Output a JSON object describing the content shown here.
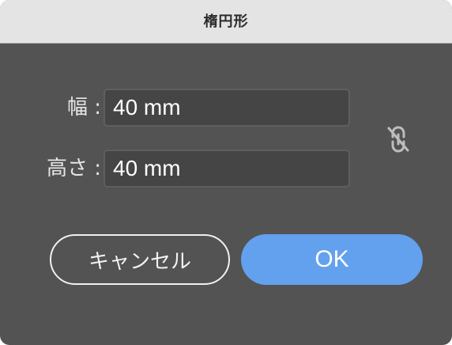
{
  "dialog": {
    "title": "楕円形"
  },
  "fields": {
    "width": {
      "label": "幅 :",
      "value": "40 mm"
    },
    "height": {
      "label": "高さ :",
      "value": "40 mm"
    }
  },
  "link_toggle": {
    "icon": "unlink-icon",
    "state": "unlinked"
  },
  "buttons": {
    "cancel_label": "キャンセル",
    "ok_label": "OK"
  },
  "colors": {
    "panel_bg": "#535353",
    "titlebar_bg": "#e4e4e4",
    "input_bg": "#454545",
    "accent": "#63a1ee"
  }
}
